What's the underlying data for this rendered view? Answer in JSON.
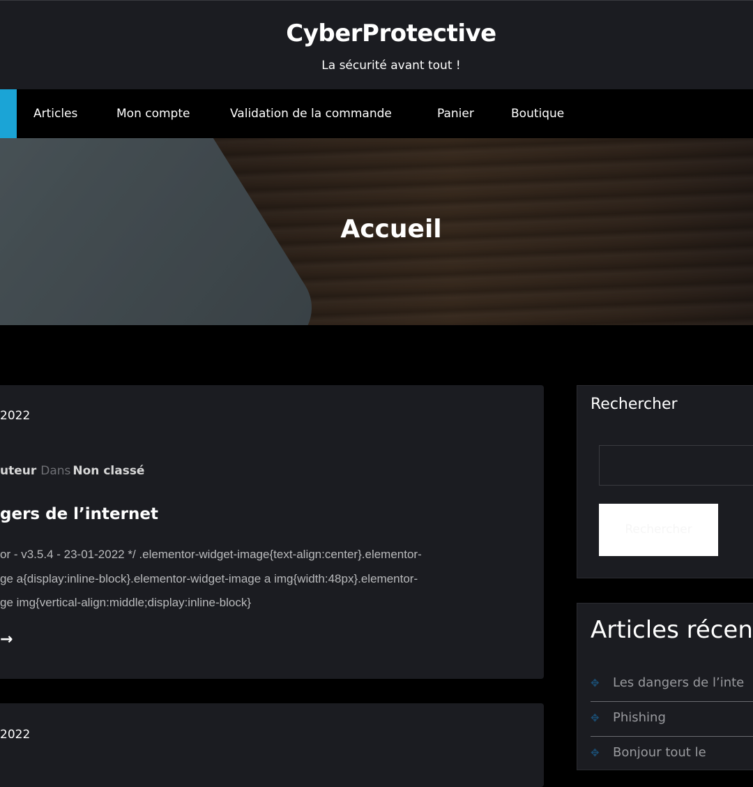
{
  "site": {
    "title": "CyberProtective",
    "tagline": "La sécurité avant tout !"
  },
  "nav": {
    "items": [
      {
        "label": "Articles"
      },
      {
        "label": "Mon compte"
      },
      {
        "label": "Validation de la commande"
      },
      {
        "label": "Panier"
      },
      {
        "label": "Boutique"
      }
    ],
    "accent_color": "#1ba4d6"
  },
  "hero": {
    "title": "Accueil"
  },
  "posts": [
    {
      "date": "2022",
      "author": "uteur",
      "in_label": "Dans",
      "category": "Non classé",
      "title": "gers de l’internet",
      "excerpt_lines": [
        "or - v3.5.4 - 23-01-2022 */ .elementor-widget-image{text-align:center}.elementor-",
        "ge a{display:inline-block}.elementor-widget-image a img{width:48px}.elementor-",
        "ge img{vertical-align:middle;display:inline-block}"
      ],
      "read_more": "→"
    },
    {
      "date": "2022"
    }
  ],
  "sidebar": {
    "search": {
      "title": "Rechercher",
      "input_value": "",
      "button_label": "Rechercher"
    },
    "recent": {
      "title": "Articles récen",
      "icon": "diamond-bullet-icon",
      "items": [
        {
          "label": "Les dangers de l’inte"
        },
        {
          "label": "Phishing"
        },
        {
          "label": "Bonjour tout le"
        }
      ]
    }
  }
}
